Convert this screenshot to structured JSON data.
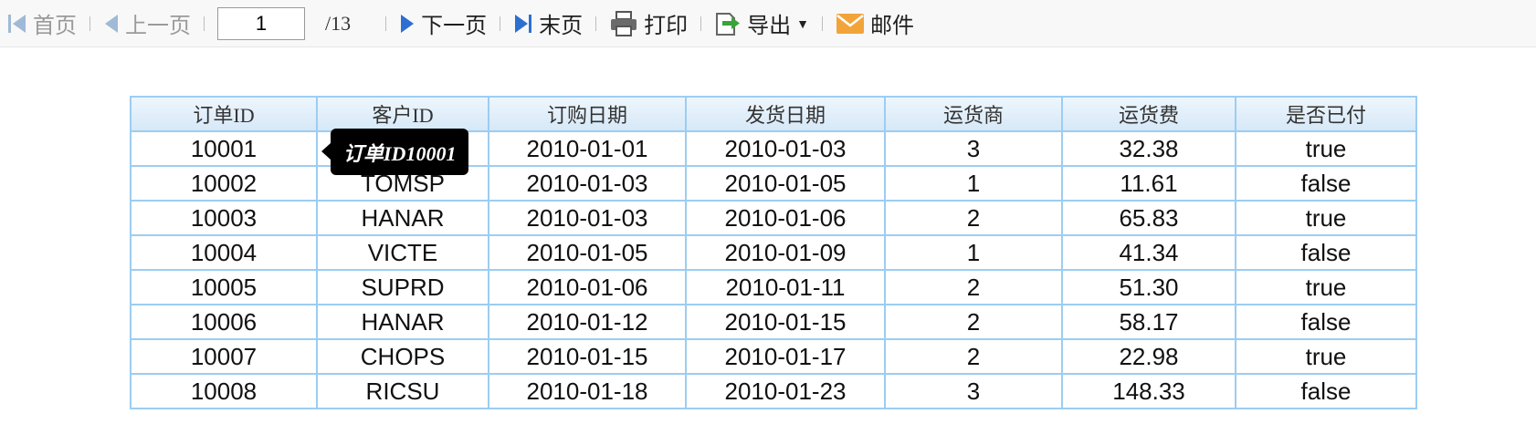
{
  "toolbar": {
    "first_label": "首页",
    "prev_label": "上一页",
    "page_value": "1",
    "page_total": "/13",
    "next_label": "下一页",
    "last_label": "末页",
    "print_label": "打印",
    "export_label": "导出",
    "mail_label": "邮件"
  },
  "table": {
    "headers": [
      "订单ID",
      "客户ID",
      "订购日期",
      "发货日期",
      "运货商",
      "运货费",
      "是否已付"
    ],
    "rows": [
      [
        "10001",
        "",
        "2010-01-01",
        "2010-01-03",
        "3",
        "32.38",
        "true"
      ],
      [
        "10002",
        "TOMSP",
        "2010-01-03",
        "2010-01-05",
        "1",
        "11.61",
        "false"
      ],
      [
        "10003",
        "HANAR",
        "2010-01-03",
        "2010-01-06",
        "2",
        "65.83",
        "true"
      ],
      [
        "10004",
        "VICTE",
        "2010-01-05",
        "2010-01-09",
        "1",
        "41.34",
        "false"
      ],
      [
        "10005",
        "SUPRD",
        "2010-01-06",
        "2010-01-11",
        "2",
        "51.30",
        "true"
      ],
      [
        "10006",
        "HANAR",
        "2010-01-12",
        "2010-01-15",
        "2",
        "58.17",
        "false"
      ],
      [
        "10007",
        "CHOPS",
        "2010-01-15",
        "2010-01-17",
        "2",
        "22.98",
        "true"
      ],
      [
        "10008",
        "RICSU",
        "2010-01-18",
        "2010-01-23",
        "3",
        "148.33",
        "false"
      ]
    ]
  },
  "tooltip": {
    "text": "订单ID10001"
  },
  "colors": {
    "grid_border": "#9ccdf2",
    "nav_icon": "#2d6fd0",
    "disabled_icon": "#9fb9d6",
    "mail_icon": "#f2a43a",
    "export_arrow": "#3aa33a"
  }
}
